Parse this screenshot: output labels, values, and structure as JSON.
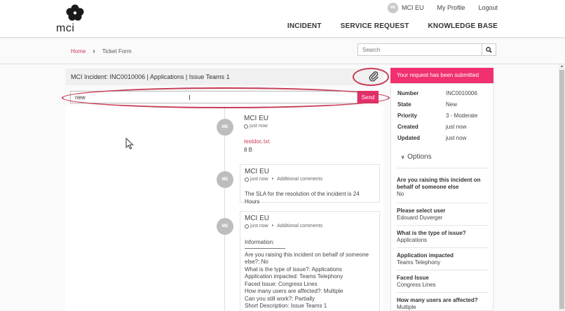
{
  "brand": {
    "logo_text": "mci"
  },
  "user": {
    "initials": "ME",
    "name": "MCI EU"
  },
  "top_links": {
    "profile": "My Profile",
    "logout": "Logout"
  },
  "nav": [
    "INCIDENT",
    "SERVICE REQUEST",
    "KNOWLEDGE BASE"
  ],
  "breadcrumb": {
    "home": "Home",
    "current": "Ticket Form"
  },
  "search": {
    "placeholder": "Search"
  },
  "ticket": {
    "title": "MCI Incident: INC0010006 | Applications | Issue Teams 1"
  },
  "comment": {
    "value": "new",
    "send_label": "Send"
  },
  "stream": [
    {
      "author": "MCI EU",
      "time": "just now",
      "attachment": "testdoc.txt",
      "size": "8 B"
    },
    {
      "author": "MCI EU",
      "time": "just now",
      "type": "Additional comments",
      "body": "The SLA for the resolution of the incident is 24 Hours"
    },
    {
      "author": "MCI EU",
      "time": "just now",
      "type": "Additional comments",
      "header": "Information:",
      "lines": [
        "Are you raising this incident on behalf of someone",
        "else?: No",
        "What is the type of issue?: Applications",
        "Application impacted: Teams Telephony",
        "Faced Issue: Congress Lines",
        "How many users are affected?: Multiple",
        "Can you still work?: Partially",
        "Short Description: Issue Teams 1"
      ]
    }
  ],
  "notice": "Your request has been submitted",
  "details": {
    "number_label": "Number",
    "number": "INC0010006",
    "state_label": "State",
    "state": "New",
    "priority_label": "Priority",
    "priority": "3 - Moderate",
    "created_label": "Created",
    "created": "just now",
    "updated_label": "Updated",
    "updated": "just now"
  },
  "options_label": "Options",
  "fields": [
    {
      "label": "Are you raising this incident on behalf of someone else",
      "value": "No"
    },
    {
      "label": "Please select user",
      "value": "Edouard Duverger"
    },
    {
      "label": "What is the type of issue?",
      "value": "Applications"
    },
    {
      "label": "Application impacted",
      "value": "Teams Telephony"
    },
    {
      "label": "Faced Issue",
      "value": "Congress Lines"
    },
    {
      "label": "How many users are affected?",
      "value": "Multiple"
    }
  ],
  "colors": {
    "accent": "#e62e6b",
    "notice": "#f0306f",
    "link": "#c73b54",
    "annotation": "#c73b54"
  }
}
